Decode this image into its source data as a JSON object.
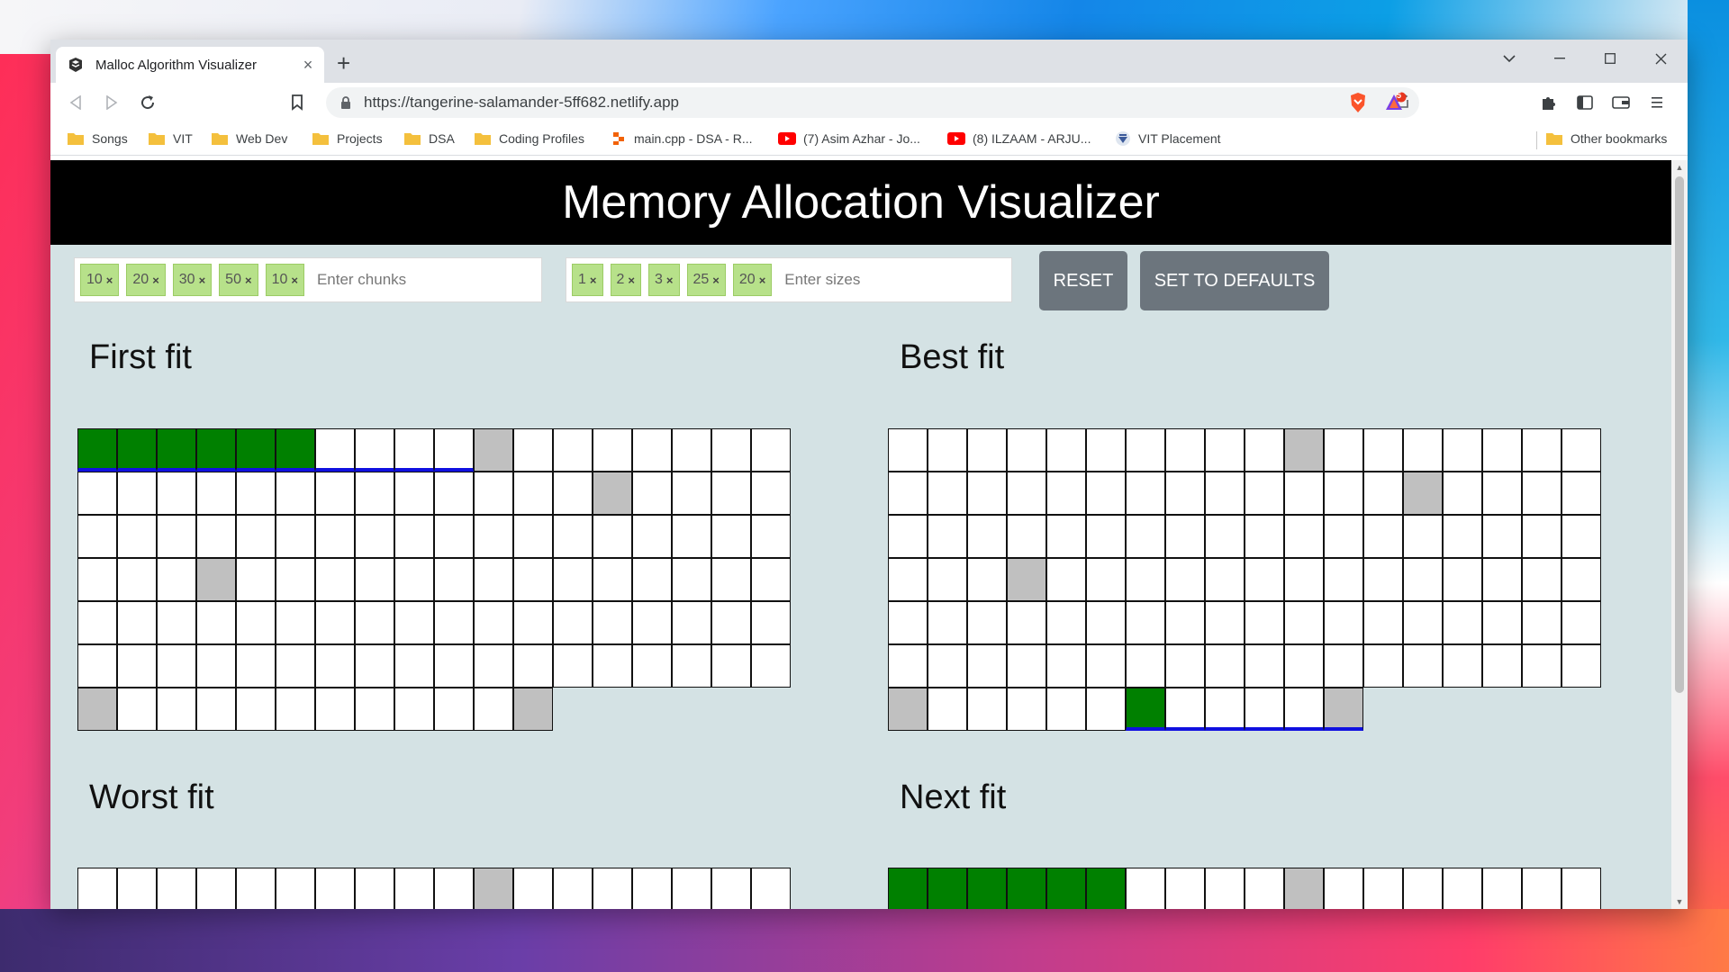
{
  "browser": {
    "tab_title": "Malloc Algorithm Visualizer",
    "tab_close": "×",
    "new_tab": "+",
    "url": "https://tangerine-salamander-5ff682.netlify.app",
    "brave_badge": "5",
    "bookmarks": [
      "Songs",
      "VIT",
      "Web Dev",
      "Projects",
      "DSA",
      "Coding Profiles",
      "main.cpp - DSA - R...",
      "(7) Asim Azhar - Jo...",
      "(8) ILZAAM - ARJU...",
      "VIT Placement"
    ],
    "other_bookmarks": "Other bookmarks"
  },
  "page": {
    "title": "Memory Allocation Visualizer",
    "chunks": {
      "tags": [
        "10",
        "20",
        "30",
        "50",
        "10"
      ],
      "placeholder": "Enter chunks",
      "remove_symbol": "×"
    },
    "sizes": {
      "tags": [
        "1",
        "2",
        "3",
        "25",
        "20"
      ],
      "placeholder": "Enter sizes",
      "remove_symbol": "×"
    },
    "reset_label": "RESET",
    "defaults_label": "SET TO DEFAULTS",
    "sections": {
      "first_fit": "First fit",
      "best_fit": "Best fit",
      "worst_fit": "Worst fit",
      "next_fit": "Next fit"
    }
  },
  "grids": {
    "first_fit": {
      "total_cells": 120,
      "allocated": [
        0,
        1,
        2,
        3,
        4,
        5
      ],
      "chunk_boundaries": [
        10,
        31,
        57,
        108,
        119
      ],
      "underlined": [
        0,
        1,
        2,
        3,
        4,
        5,
        6,
        7,
        8,
        9
      ]
    },
    "best_fit": {
      "total_cells": 120,
      "allocated": [
        114
      ],
      "chunk_boundaries": [
        10,
        31,
        57,
        108,
        119
      ],
      "underlined": [
        114,
        115,
        116,
        117,
        118,
        119,
        120,
        121,
        122,
        123
      ]
    },
    "worst_fit": {
      "total_cells": 18,
      "allocated": [],
      "chunk_boundaries": [
        10
      ],
      "underlined": []
    },
    "next_fit": {
      "total_cells": 18,
      "allocated": [
        0,
        1,
        2,
        3,
        4,
        5
      ],
      "chunk_boundaries": [
        10
      ],
      "underlined": []
    }
  },
  "colors": {
    "allocated": "#008000",
    "boundary": "#c0c0c0",
    "free": "#ffffff",
    "highlight": "#1010e0",
    "button": "#6c757d",
    "tag": "#b7e18a",
    "page_background": "#d4e2e4"
  }
}
